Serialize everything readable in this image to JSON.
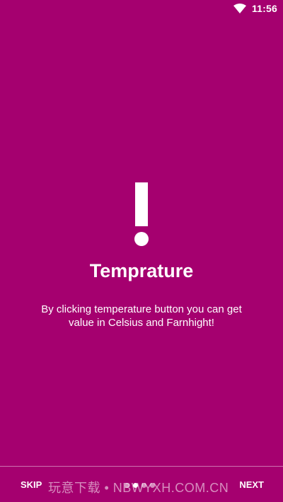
{
  "status_bar": {
    "time": "11:56",
    "wifi_icon": "wifi-icon"
  },
  "colors": {
    "background": "#A5006F",
    "text": "#FFFFFF"
  },
  "slide": {
    "icon": "exclamation-icon",
    "title": "Temprature",
    "description": "By clicking temperature button you can get value in Celsius and Farnhight!"
  },
  "bottom_bar": {
    "skip_label": "SKIP",
    "next_label": "NEXT",
    "current_page": 2,
    "total_pages": 4
  },
  "watermark": "玩意下载 • NBWYXH.COM.CN"
}
